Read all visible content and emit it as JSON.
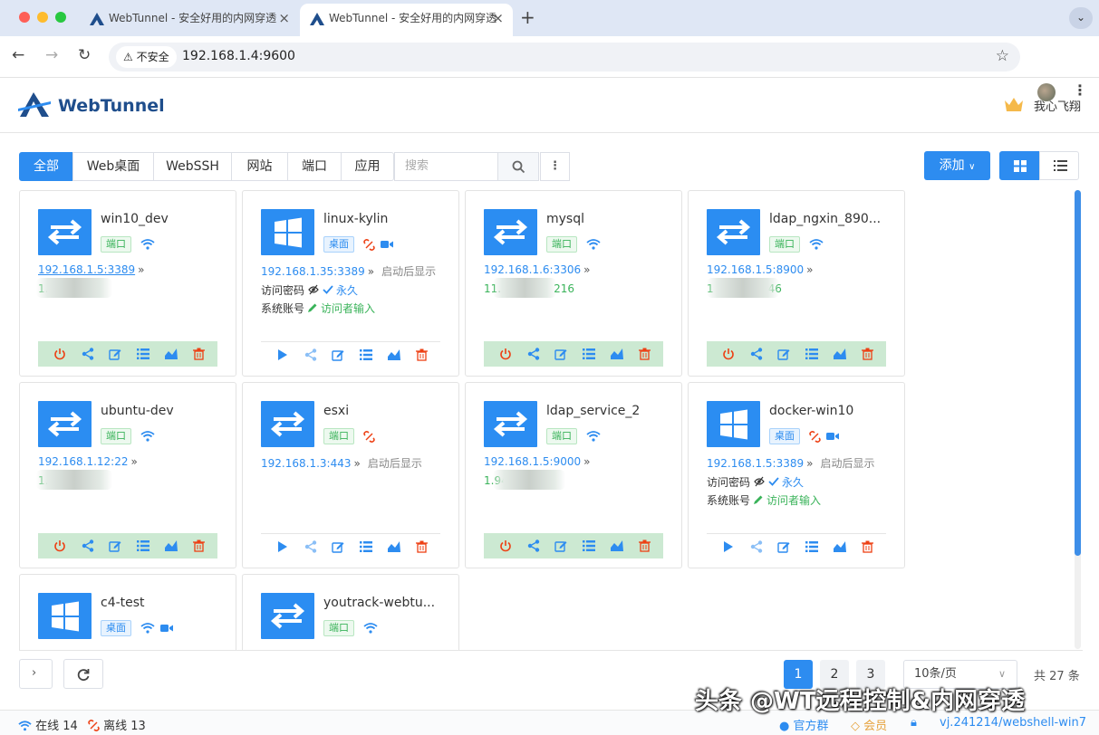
{
  "browser": {
    "tabs": [
      {
        "title": "WebTunnel - 安全好用的内网穿透",
        "active": false
      },
      {
        "title": "WebTunnel - 安全好用的内网穿透",
        "active": true
      }
    ],
    "security_label": "不安全",
    "url": "192.168.1.4:9600"
  },
  "header": {
    "brand": "WebTunnel",
    "user": "我心飞翔"
  },
  "toolbar": {
    "filters": [
      "全部",
      "Web桌面",
      "WebSSH",
      "网站",
      "端口",
      "应用"
    ],
    "active_filter": "全部",
    "search_placeholder": "搜索",
    "add_label": "添加",
    "view_mode": "grid"
  },
  "labels": {
    "port_badge": "端口",
    "desktop_badge": "桌面",
    "start_hint": "启动后显示",
    "password_label": "访问密码",
    "permanent": "永久",
    "account_label": "系统账号",
    "visitor_input": "访问者输入"
  },
  "cards": [
    {
      "name": "win10_dev",
      "type": "端口",
      "address": "192.168.1.5:3389",
      "ext": "1.9"
    },
    {
      "name": "linux-kylin",
      "type": "桌面",
      "address": "192.168.1.35:3389",
      "hint": "启动后显示"
    },
    {
      "name": "mysql",
      "type": "端口",
      "address": "192.168.1.6:3306",
      "ext": "11.",
      "ext_tail": "216"
    },
    {
      "name": "ldap_ngxin_890...",
      "type": "端口",
      "address": "192.168.1.5:8900",
      "ext": "1",
      "ext_tail": "46"
    },
    {
      "name": "ubuntu-dev",
      "type": "端口",
      "address": "192.168.1.12:22",
      "ext": "1.9"
    },
    {
      "name": "esxi",
      "type": "端口",
      "address": "192.168.1.3:443",
      "hint": "启动后显示"
    },
    {
      "name": "ldap_service_2",
      "type": "端口",
      "address": "192.168.1.5:9000",
      "ext": "1.94"
    },
    {
      "name": "docker-win10",
      "type": "桌面",
      "address": "192.168.1.5:3389",
      "hint": "启动后显示"
    },
    {
      "name": "c4-test",
      "type": "桌面"
    },
    {
      "name": "youtrack-webtu...",
      "type": "端口"
    }
  ],
  "pagination": {
    "pages": [
      "1",
      "2",
      "3"
    ],
    "current": "1",
    "page_size": "10条/页",
    "total": "共 27 条"
  },
  "status": {
    "online": "在线 14",
    "offline": "离线 13",
    "group": "官方群",
    "member": "会员",
    "version": "vj.241214/webshell-win7"
  },
  "watermark": "头条 @WT远程控制&内网穿透",
  "colors": {
    "accent": "#2d8cf0",
    "online_green": "#3ab35a",
    "danger": "#ed4014",
    "action_bar": "#cce9d2"
  }
}
